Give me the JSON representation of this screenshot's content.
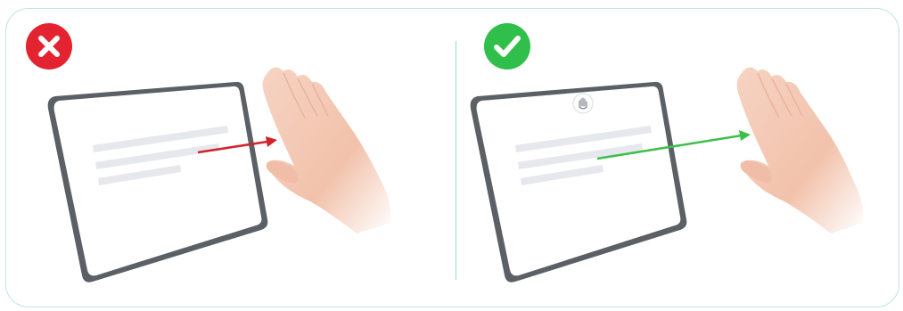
{
  "panels": [
    {
      "id": "incorrect",
      "status": "wrong",
      "badge_icon": "cross-icon",
      "badge_color": "#e3232f",
      "arrow_color": "#d2232a",
      "show_gesture_indicator": false
    },
    {
      "id": "correct",
      "status": "right",
      "badge_icon": "check-icon",
      "badge_color": "#2fbf4a",
      "arrow_color": "#3cc04a",
      "show_gesture_indicator": true,
      "indicator_icon": "hand-icon"
    }
  ],
  "colors": {
    "frame_border": "#bfe4e8",
    "divider": "#9fd3da",
    "tablet_body": "#5b5f66",
    "tablet_screen": "#ffffff",
    "text_lines": "#e6e8ee",
    "skin": "#f3c6b1"
  }
}
